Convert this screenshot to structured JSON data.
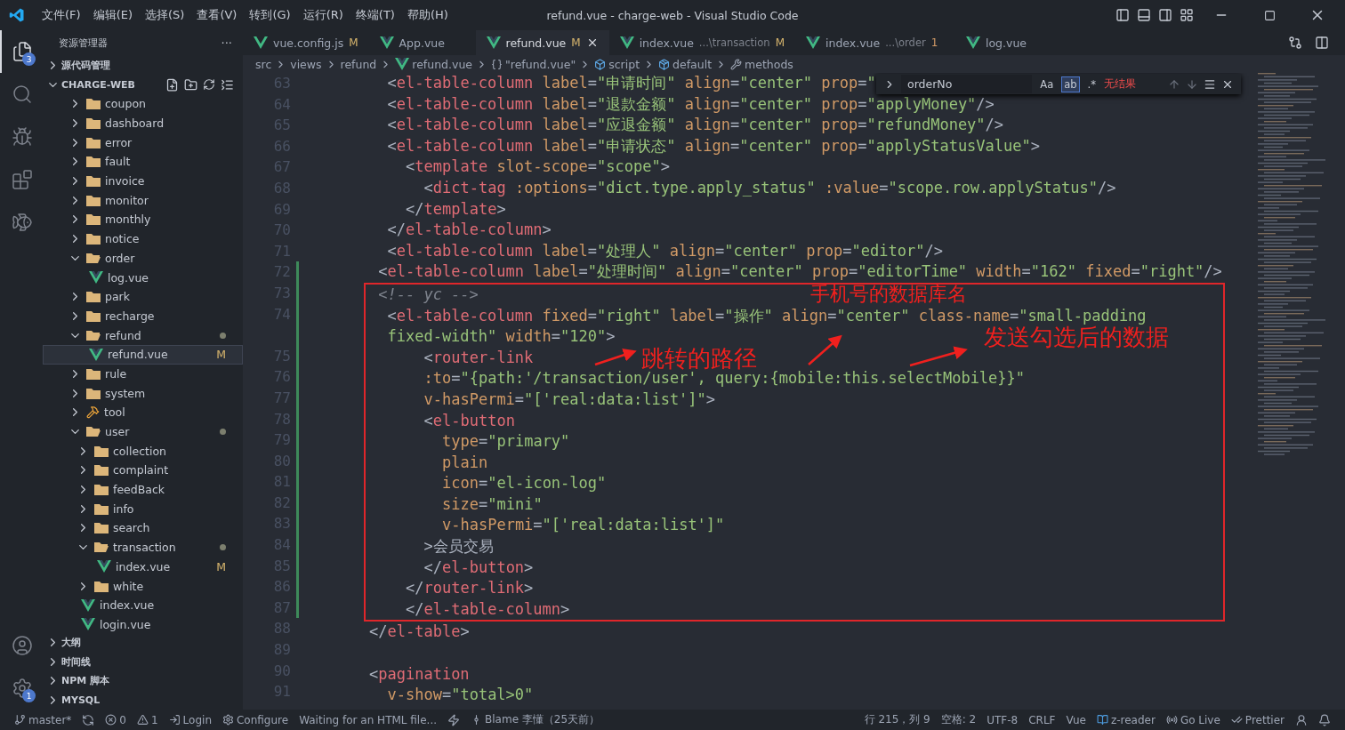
{
  "window": {
    "title": "refund.vue - charge-web - Visual Studio Code"
  },
  "menu": [
    "文件(F)",
    "编辑(E)",
    "选择(S)",
    "查看(V)",
    "转到(G)",
    "运行(R)",
    "终端(T)",
    "帮助(H)"
  ],
  "activity_bar": [
    {
      "kind": "files",
      "badge": "3",
      "selected": true
    },
    {
      "kind": "search",
      "selected": false
    },
    {
      "kind": "debug",
      "selected": false
    },
    {
      "kind": "extensions",
      "selected": false
    },
    {
      "kind": "fish",
      "selected": false
    }
  ],
  "activity_bottom": [
    {
      "kind": "account"
    },
    {
      "kind": "settings",
      "badge": "1"
    }
  ],
  "sidebar": {
    "title": "资源管理器",
    "more": "···",
    "sections_top": [
      {
        "label": "源代码管理",
        "expanded": false
      },
      {
        "label": "CHARGE-WEB",
        "expanded": true
      }
    ],
    "tree": [
      {
        "label": "coupon",
        "kind": "folder",
        "expanded": false,
        "selected": false
      },
      {
        "label": "dashboard",
        "kind": "folder",
        "expanded": false,
        "selected": false
      },
      {
        "label": "error",
        "kind": "folder",
        "expanded": false,
        "selected": false
      },
      {
        "label": "fault",
        "kind": "folder",
        "expanded": false,
        "selected": false
      },
      {
        "label": "invoice",
        "kind": "folder",
        "expanded": false,
        "selected": false
      },
      {
        "label": "monitor",
        "kind": "folder",
        "expanded": false,
        "selected": false
      },
      {
        "label": "monthly",
        "kind": "folder",
        "expanded": false,
        "selected": false
      },
      {
        "label": "notice",
        "kind": "folder",
        "expanded": false,
        "selected": false
      },
      {
        "label": "order",
        "kind": "folder",
        "expanded": true,
        "selected": false,
        "children": [
          {
            "label": "log.vue",
            "kind": "vue",
            "selected": false
          }
        ]
      },
      {
        "label": "park",
        "kind": "folder",
        "expanded": false,
        "selected": false
      },
      {
        "label": "recharge",
        "kind": "folder",
        "expanded": false,
        "selected": false
      },
      {
        "label": "refund",
        "kind": "folder",
        "expanded": true,
        "selected": false,
        "dot": true,
        "children": [
          {
            "label": "refund.vue",
            "kind": "vue",
            "selected": true,
            "badge": "M"
          }
        ]
      },
      {
        "label": "rule",
        "kind": "folder",
        "expanded": false,
        "selected": false
      },
      {
        "label": "system",
        "kind": "folder",
        "expanded": false,
        "selected": false
      },
      {
        "label": "tool",
        "kind": "tool",
        "expanded": false,
        "selected": false
      },
      {
        "label": "user",
        "kind": "folder",
        "expanded": true,
        "selected": false,
        "dot": true,
        "children": [
          {
            "label": "collection",
            "kind": "folder",
            "expanded": false,
            "selected": false
          },
          {
            "label": "complaint",
            "kind": "folder",
            "expanded": false,
            "selected": false
          },
          {
            "label": "feedBack",
            "kind": "folder",
            "expanded": false,
            "selected": false
          },
          {
            "label": "info",
            "kind": "folder",
            "expanded": false,
            "selected": false
          },
          {
            "label": "search",
            "kind": "folder",
            "expanded": false,
            "selected": false
          },
          {
            "label": "transaction",
            "kind": "folder",
            "expanded": true,
            "selected": false,
            "dot": true,
            "children": [
              {
                "label": "index.vue",
                "kind": "vue",
                "selected": false,
                "badge": "M"
              }
            ]
          },
          {
            "label": "white",
            "kind": "folder",
            "expanded": false,
            "selected": false
          }
        ]
      },
      {
        "label": "index.vue",
        "kind": "vue",
        "selected": false
      },
      {
        "label": "login.vue",
        "kind": "vue",
        "selected": false
      }
    ],
    "sections_bottom": [
      {
        "label": "大纲",
        "expanded": false
      },
      {
        "label": "时间线",
        "expanded": false
      },
      {
        "label": "NPM 脚本",
        "expanded": false
      },
      {
        "label": "MYSQL",
        "expanded": false
      }
    ]
  },
  "tabs": [
    {
      "label": "vue.config.js",
      "kind": "js",
      "badge": "M",
      "selected": false
    },
    {
      "label": "App.vue",
      "kind": "vue",
      "selected": false
    },
    {
      "label": "refund.vue",
      "kind": "vue",
      "badge": "M",
      "selected": true
    },
    {
      "label": "index.vue",
      "kind": "vue",
      "description": "...\\transaction",
      "badge": "M",
      "selected": false
    },
    {
      "label": "index.vue",
      "kind": "vue",
      "description": "...\\order",
      "badge": "1",
      "selected": false
    },
    {
      "label": "log.vue",
      "kind": "vue",
      "selected": false
    }
  ],
  "breadcrumb": [
    {
      "label": "src",
      "kind": "plain"
    },
    {
      "label": "views",
      "kind": "plain"
    },
    {
      "label": "refund",
      "kind": "plain"
    },
    {
      "label": "refund.vue",
      "kind": "vue"
    },
    {
      "label": "\"refund.vue\"",
      "kind": "braces"
    },
    {
      "label": "script",
      "kind": "cube"
    },
    {
      "label": "default",
      "kind": "module"
    },
    {
      "label": "methods",
      "kind": "wrench"
    }
  ],
  "find": {
    "value": "orderNo",
    "options": [
      {
        "label": "Aa",
        "selected": false
      },
      {
        "label": "ab",
        "selected": true
      },
      {
        "label": ".*",
        "selected": false
      }
    ],
    "result": "无结果"
  },
  "code": {
    "before": [
      {
        "number": "63",
        "modified": false,
        "text": "  <el-table-column label=\"申请时间\" align=\"center\" prop=\""
      },
      {
        "number": "64",
        "modified": false,
        "text": "  <el-table-column label=\"退款金额\" align=\"center\" prop=\"applyMoney\"/>"
      },
      {
        "number": "65",
        "modified": false,
        "text": "  <el-table-column label=\"应退金额\" align=\"center\" prop=\"refundMoney\"/>"
      },
      {
        "number": "66",
        "modified": false,
        "text": "  <el-table-column label=\"申请状态\" align=\"center\" prop=\"applyStatusValue\">"
      },
      {
        "number": "67",
        "modified": false,
        "text": "    <template slot-scope=\"scope\">"
      },
      {
        "number": "68",
        "modified": false,
        "text": "      <dict-tag :options=\"dict.type.apply_status\" :value=\"scope.row.applyStatus\"/>"
      },
      {
        "number": "69",
        "modified": false,
        "text": "    </template>"
      },
      {
        "number": "70",
        "modified": false,
        "text": "  </el-table-column>"
      },
      {
        "number": "71",
        "modified": false,
        "text": "  <el-table-column label=\"处理人\" align=\"center\" prop=\"editor\"/>"
      },
      {
        "number": "72",
        "modified": true,
        "text": " <el-table-column label=\"处理时间\" align=\"center\" prop=\"editorTime\" width=\"162\" fixed=\"right\"/>"
      }
    ],
    "boxed": [
      {
        "number": "73",
        "modified": true,
        "text": " <!-- yc -->"
      },
      {
        "number": "74",
        "modified": true,
        "text": "  <el-table-column fixed=\"right\" label=\"操作\" align=\"center\" class-name=\"small-padding"
      },
      {
        "modified": true,
        "text": "  fixed-width\" width=\"120\">"
      },
      {
        "number": "75",
        "modified": true,
        "text": "      <router-link"
      },
      {
        "number": "76",
        "modified": true,
        "text": "      :to=\"{path:'/transaction/user', query:{mobile:this.selectMobile}}\""
      },
      {
        "number": "77",
        "modified": true,
        "text": "      v-hasPermi=\"['real:data:list']\">"
      },
      {
        "number": "78",
        "modified": true,
        "text": "      <el-button"
      },
      {
        "number": "79",
        "modified": true,
        "text": "        type=\"primary\""
      },
      {
        "number": "80",
        "modified": true,
        "text": "        plain"
      },
      {
        "number": "81",
        "modified": true,
        "text": "        icon=\"el-icon-log\""
      },
      {
        "number": "82",
        "modified": true,
        "text": "        size=\"mini\""
      },
      {
        "number": "83",
        "modified": true,
        "text": "        v-hasPermi=\"['real:data:list']\""
      },
      {
        "number": "84",
        "modified": true,
        "text": "      >会员交易"
      },
      {
        "number": "85",
        "modified": true,
        "text": "      </el-button>"
      },
      {
        "number": "86",
        "modified": true,
        "text": "    </router-link>"
      },
      {
        "number": "87",
        "modified": true,
        "text": "    </el-table-column>"
      }
    ],
    "after": [
      {
        "number": "88",
        "modified": false,
        "text": "</el-table>"
      },
      {
        "number": "89",
        "modified": false
      },
      {
        "number": "90",
        "modified": false,
        "text": "<pagination"
      },
      {
        "number": "91",
        "modified": false,
        "text": "  v-show=\"total>0\""
      }
    ],
    "annotations": [
      "手机号的数据库名",
      "跳转的路径",
      "发送勾选后的数据"
    ]
  },
  "status_bar": {
    "left": [
      {
        "kind": "branch",
        "label": "master*"
      },
      {
        "kind": "sync"
      },
      {
        "kind": "errors",
        "label": "0"
      },
      {
        "kind": "warnings",
        "label": "1"
      },
      {
        "kind": "login",
        "label": "Login"
      },
      {
        "kind": "gear",
        "label": "Configure"
      },
      {
        "kind": "plain",
        "label": "Waiting for an HTML file..."
      },
      {
        "kind": "bolt"
      },
      {
        "kind": "blame",
        "label": "Blame 李懂（25天前）"
      }
    ],
    "right": [
      {
        "kind": "plain",
        "label": "行 215，列 9"
      },
      {
        "kind": "plain",
        "label": "空格: 2"
      },
      {
        "kind": "plain",
        "label": "UTF-8"
      },
      {
        "kind": "plain",
        "label": "CRLF"
      },
      {
        "kind": "plain",
        "label": "Vue"
      },
      {
        "kind": "book",
        "label": "z-reader"
      },
      {
        "kind": "radio",
        "label": "Go Live"
      },
      {
        "kind": "check",
        "label": "Prettier"
      },
      {
        "kind": "person"
      },
      {
        "kind": "bell"
      }
    ]
  }
}
